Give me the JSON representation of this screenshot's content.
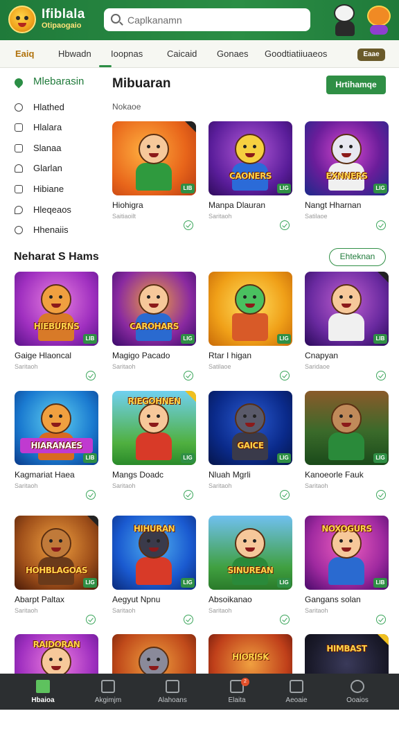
{
  "header": {
    "logo_title": "Ifiblala",
    "logo_sub": "Otipaogaio",
    "search_placeholder": "Caplkanamn"
  },
  "tabs": [
    "Eaiq",
    "Hbwadn",
    "Ioopnas",
    "Caicaid",
    "Gonaes",
    "Goodtiatiiuaeos"
  ],
  "tab_badge": "Eaae",
  "sidebar": {
    "items": [
      {
        "label": "Mlebarasin",
        "icon": "location-pin-icon"
      },
      {
        "label": "Hlathed",
        "icon": "clock-icon"
      },
      {
        "label": "Hlalara",
        "icon": "lock-icon"
      },
      {
        "label": "Slanaa",
        "icon": "calendar-icon"
      },
      {
        "label": "Glarlan",
        "icon": "bell-icon"
      },
      {
        "label": "Hibiane",
        "icon": "bag-icon"
      },
      {
        "label": "Hleqeaos",
        "icon": "chat-icon"
      },
      {
        "label": "Hhenaiis",
        "icon": "info-icon"
      }
    ]
  },
  "main": {
    "title": "Mibuaran",
    "subtitle": "Nokaoe",
    "primary_button": "Hrtihamqe"
  },
  "section": {
    "title": "Neharat S Hams",
    "button": "Ehteknan"
  },
  "featured_games": [
    {
      "name": "Hiohigra",
      "provider": "Saitiaoilt",
      "banner": "",
      "tag": "LIB"
    },
    {
      "name": "Manpa Dlauran",
      "provider": "Saritaoh",
      "banner": "CAONERS",
      "tag": "LIG"
    },
    {
      "name": "Nangt Hharnan",
      "provider": "Satilaoe",
      "banner": "EXNNERS",
      "tag": "LIG"
    }
  ],
  "games": [
    {
      "name": "Gaige Hlaoncal",
      "provider": "Saritaoh",
      "banner": "HIEBURNS",
      "tag": "LIB"
    },
    {
      "name": "Magigo Pacado",
      "provider": "Saritaoh",
      "banner": "CAROHARS",
      "tag": "LIG"
    },
    {
      "name": "Rtar I higan",
      "provider": "Satilaoe",
      "banner": "",
      "tag": "LIG"
    },
    {
      "name": "Cnapyan",
      "provider": "Saridaoe",
      "banner": "",
      "tag": "LIB"
    },
    {
      "name": "Kagmariat Haea",
      "provider": "Saritaoh",
      "banner": "HIARANAES",
      "tag": "LIB"
    },
    {
      "name": "Mangs Doadc",
      "provider": "Saritaoh",
      "banner": "RIEGOHNEN",
      "tag": "LIG"
    },
    {
      "name": "Nluah Mgrli",
      "provider": "Saritaoh",
      "banner": "GAICE",
      "tag": "LIG"
    },
    {
      "name": "Kanoeorle Fauk",
      "provider": "Saritaoh",
      "banner": "",
      "tag": "LIG"
    },
    {
      "name": "Abarpt Paltax",
      "provider": "Saritaoh",
      "banner": "HOHBLAGOAS",
      "tag": "LIG"
    },
    {
      "name": "Aegyut Npnu",
      "provider": "Saritaoh",
      "banner": "HIHURAN",
      "tag": "LIG"
    },
    {
      "name": "Absoikanao",
      "provider": "Saritaoh",
      "banner": "SINUREAN",
      "tag": "LIG"
    },
    {
      "name": "Gangans solan",
      "provider": "Saritaoh",
      "banner": "NOXOGURS",
      "tag": "LIB"
    },
    {
      "name": "",
      "provider": "",
      "banner": "RAIDORAN",
      "tag": ""
    },
    {
      "name": "",
      "provider": "",
      "banner": "",
      "tag": ""
    },
    {
      "name": "",
      "provider": "",
      "banner": "HIORISK",
      "tag": ""
    },
    {
      "name": "",
      "provider": "",
      "banner": "HIMBAST",
      "tag": ""
    }
  ],
  "bottom_nav": [
    {
      "label": "Hbaioa",
      "icon": "home-icon",
      "active": true
    },
    {
      "label": "Akgimjm",
      "icon": "upload-icon"
    },
    {
      "label": "Alahoans",
      "icon": "square-icon"
    },
    {
      "label": "Elaita",
      "icon": "cart-icon",
      "badge": "2"
    },
    {
      "label": "Aeoaie",
      "icon": "message-icon"
    },
    {
      "label": "Ooaios",
      "icon": "profile-icon"
    }
  ],
  "colors": {
    "brand_green": "#2b8e45",
    "header_green": "#1f7a3a",
    "nav_bg": "#2c2f31",
    "accent_orange": "#b0720c"
  }
}
